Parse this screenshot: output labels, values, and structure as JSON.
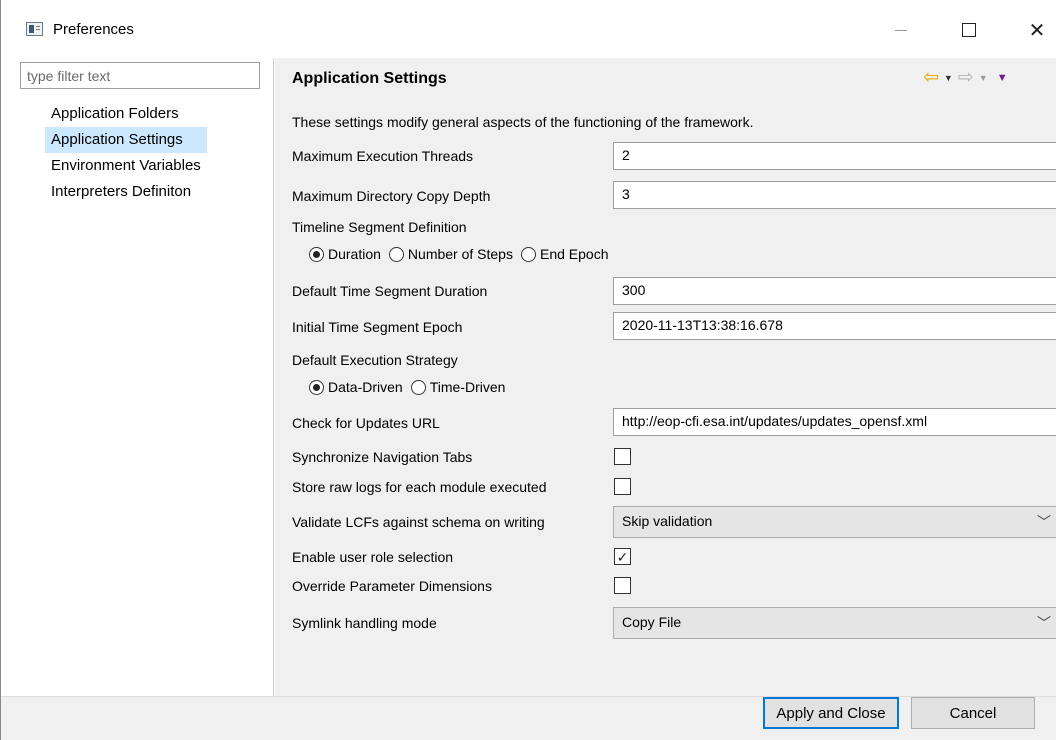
{
  "window": {
    "title": "Preferences"
  },
  "filter": {
    "placeholder": "type filter text"
  },
  "tree": {
    "items": [
      {
        "label": "Application Folders"
      },
      {
        "label": "Application Settings"
      },
      {
        "label": "Environment Variables"
      },
      {
        "label": "Interpreters Definiton"
      }
    ],
    "selected_index": 1
  },
  "page": {
    "title": "Application Settings",
    "description": "These settings modify general aspects of the functioning of the framework.",
    "max_threads": {
      "label": "Maximum Execution Threads",
      "value": "2"
    },
    "max_copy_depth": {
      "label": "Maximum Directory Copy Depth",
      "value": "3"
    },
    "timeline": {
      "label": "Timeline Segment Definition",
      "options": [
        "Duration",
        "Number of Steps",
        "End Epoch"
      ],
      "selected": "Duration"
    },
    "segment_duration": {
      "label": "Default Time Segment Duration",
      "value": "300"
    },
    "segment_epoch": {
      "label": "Initial Time Segment Epoch",
      "value": "2020-11-13T13:38:16.678"
    },
    "exec_strategy": {
      "label": "Default Execution Strategy",
      "options": [
        "Data-Driven",
        "Time-Driven"
      ],
      "selected": "Data-Driven"
    },
    "updates_url": {
      "label": "Check for Updates URL",
      "value": "http://eop-cfi.esa.int/updates/updates_opensf.xml"
    },
    "sync_tabs": {
      "label": "Synchronize Navigation Tabs",
      "checked": false
    },
    "raw_logs": {
      "label": "Store raw logs for each module executed",
      "checked": false
    },
    "validate_lcf": {
      "label": "Validate LCFs against schema on writing",
      "value": "Skip validation"
    },
    "user_role": {
      "label": "Enable user role selection",
      "checked": true,
      "mark": "✓"
    },
    "override_dims": {
      "label": "Override Parameter Dimensions",
      "checked": false
    },
    "symlink": {
      "label": "Symlink handling mode",
      "value": "Copy File"
    }
  },
  "footer": {
    "apply_label": "Apply and Close",
    "cancel_label": "Cancel"
  },
  "colors": {
    "accent": "#0078d7",
    "selection": "#cce8ff",
    "back_arrow": "#e8a400",
    "view_menu": "#6b1f8c"
  },
  "icons": {
    "back": "arrow-left-icon",
    "forward": "arrow-right-icon",
    "menu": "view-menu-icon"
  }
}
